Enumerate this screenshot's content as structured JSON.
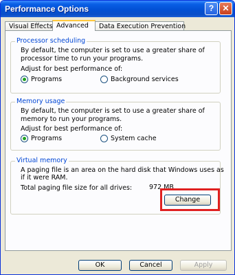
{
  "window": {
    "title": "Performance Options"
  },
  "titlebar": {
    "help_label": "?",
    "close_label": "✕"
  },
  "tabs": [
    {
      "label": "Visual Effects",
      "active": false
    },
    {
      "label": "Advanced",
      "active": true
    },
    {
      "label": "Data Execution Prevention",
      "active": false
    }
  ],
  "processor": {
    "title": "Processor scheduling",
    "desc_line1": "By default, the computer is set to use a greater share of",
    "desc_line2": "processor time to run your programs.",
    "adjust": "Adjust for best performance of:",
    "option1": "Programs",
    "option2": "Background services",
    "selected": "Programs"
  },
  "memory": {
    "title": "Memory usage",
    "desc_line1": "By default, the computer is set to use a greater share of",
    "desc_line2": "memory to run your programs.",
    "adjust": "Adjust for best performance of:",
    "option1": "Programs",
    "option2": "System cache",
    "selected": "Programs"
  },
  "virtual": {
    "title": "Virtual memory",
    "desc_line1": "A paging file is an area on the hard disk that Windows uses as",
    "desc_line2": "if it were RAM.",
    "total_label": "Total paging file size for all drives:",
    "total_value": "972 MB",
    "change_label": "Change"
  },
  "footer": {
    "ok_label": "OK",
    "cancel_label": "Cancel",
    "apply_label": "Apply"
  },
  "colors": {
    "highlight": "#e02020",
    "group_title": "#0046d5",
    "titlebar": "#0a5fe6"
  }
}
